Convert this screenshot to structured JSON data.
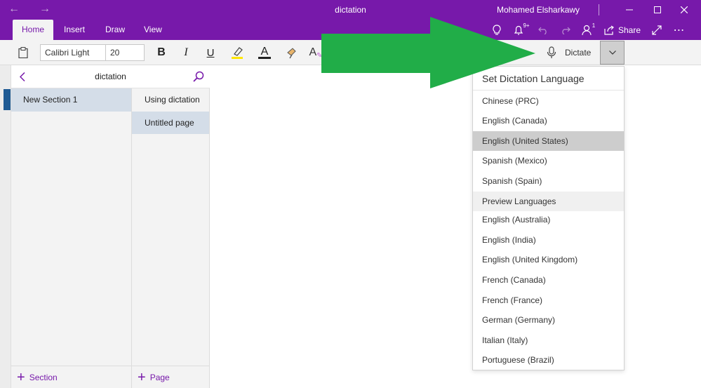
{
  "window": {
    "title": "dictation",
    "user": "Mohamed Elsharkawy",
    "notification_count": "9+",
    "people_count": "1"
  },
  "ribbon": {
    "tabs": [
      "Home",
      "Insert",
      "Draw",
      "View"
    ],
    "active_tab": "Home",
    "share_label": "Share"
  },
  "toolbar": {
    "font_name": "Calibri Light",
    "font_size": "20",
    "bold": "B",
    "italic": "I",
    "underline": "U",
    "font_color_glyph": "A",
    "dictate_label": "Dictate"
  },
  "notebook": {
    "name": "dictation",
    "sections": [
      "New Section 1"
    ],
    "pages": [
      "Using dictation",
      "Untitled page"
    ],
    "selected_page": "Untitled page",
    "add_section": "Section",
    "add_page": "Page"
  },
  "dictation_menu": {
    "title": "Set Dictation Language",
    "languages": [
      "Chinese (PRC)",
      "English (Canada)",
      "English (United States)",
      "Spanish (Mexico)",
      "Spanish (Spain)"
    ],
    "selected": "English (United States)",
    "preview_header": "Preview Languages",
    "preview_languages": [
      "English (Australia)",
      "English (India)",
      "English (United Kingdom)",
      "French (Canada)",
      "French (France)",
      "German (Germany)",
      "Italian (Italy)",
      "Portuguese (Brazil)"
    ]
  },
  "colors": {
    "accent": "#7719aa",
    "arrow": "#21ad48",
    "highlight": "#ffe600"
  }
}
